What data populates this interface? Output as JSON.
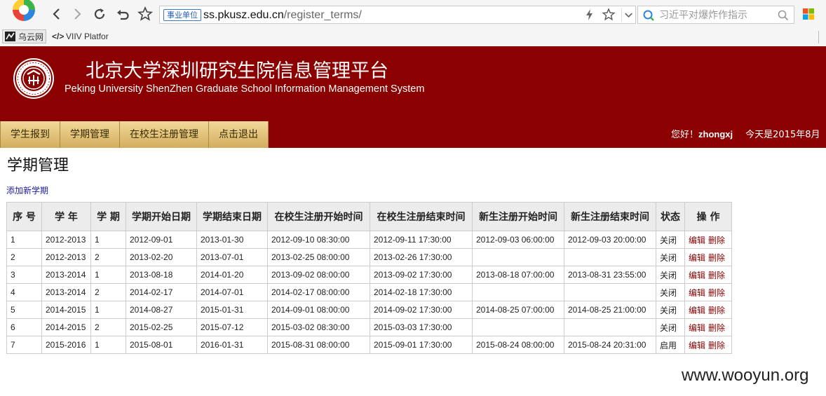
{
  "browser": {
    "url_badge": "事业单位",
    "url_domain": "ss.pkusz.edu.cn",
    "url_path": "/register_terms/",
    "search_placeholder": "习近平对爆炸作指示",
    "bookmarks": [
      {
        "label": "乌云网",
        "icon": "wooyun-icon"
      },
      {
        "label": "VIIV Platfor",
        "icon": "code-icon"
      }
    ]
  },
  "site": {
    "title": "北京大学深圳研究生院信息管理平台",
    "subtitle": "Peking University ShenZhen Graduate School Information Management System",
    "brand_color": "#8b0000"
  },
  "menu": [
    "学生报到",
    "学期管理",
    "在校生注册管理",
    "点击退出"
  ],
  "user": {
    "greeting": "您好！",
    "name": "zhongxj",
    "date_text": "今天是2015年8月"
  },
  "page": {
    "title": "学期管理",
    "add_link": "添加新学期"
  },
  "table": {
    "columns": [
      "序 号",
      "学 年",
      "学 期",
      "学期开始日期",
      "学期结束日期",
      "在校生注册开始时间",
      "在校生注册结束时间",
      "新生注册开始时间",
      "新生注册结束时间",
      "状态",
      "操 作"
    ],
    "rows": [
      [
        "1",
        "2012-2013",
        "1",
        "2012-09-01",
        "2013-01-30",
        "2012-09-10 08:30:00",
        "2012-09-11 17:30:00",
        "2012-09-03 06:00:00",
        "2012-09-03 20:00:00",
        "关闭"
      ],
      [
        "2",
        "2012-2013",
        "2",
        "2013-02-20",
        "2013-07-01",
        "2013-02-25 08:00:00",
        "2013-02-26 17:30:00",
        "",
        "",
        "关闭"
      ],
      [
        "3",
        "2013-2014",
        "1",
        "2013-08-18",
        "2014-01-20",
        "2013-09-02 08:00:00",
        "2013-09-02 17:30:00",
        "2013-08-18 07:00:00",
        "2013-08-31 23:55:00",
        "关闭"
      ],
      [
        "4",
        "2013-2014",
        "2",
        "2014-02-17",
        "2014-07-01",
        "2014-02-17 08:00:00",
        "2014-02-18 17:30:00",
        "",
        "",
        "关闭"
      ],
      [
        "5",
        "2014-2015",
        "1",
        "2014-08-27",
        "2015-01-31",
        "2014-09-01 08:00:00",
        "2014-09-02 17:30:00",
        "2014-08-25 07:00:00",
        "2014-08-25 21:00:00",
        "关闭"
      ],
      [
        "6",
        "2014-2015",
        "2",
        "2015-02-25",
        "2015-07-12",
        "2015-03-02 08:30:00",
        "2015-03-03 17:30:00",
        "",
        "",
        "关闭"
      ],
      [
        "7",
        "2015-2016",
        "1",
        "2015-08-01",
        "2016-01-31",
        "2015-08-31 08:00:00",
        "2015-09-01 17:30:00",
        "2015-08-24 08:00:00",
        "2015-08-24 20:31:00",
        "启用"
      ]
    ],
    "actions": [
      "编辑",
      "删除"
    ]
  },
  "watermark": "www.wooyun.org"
}
